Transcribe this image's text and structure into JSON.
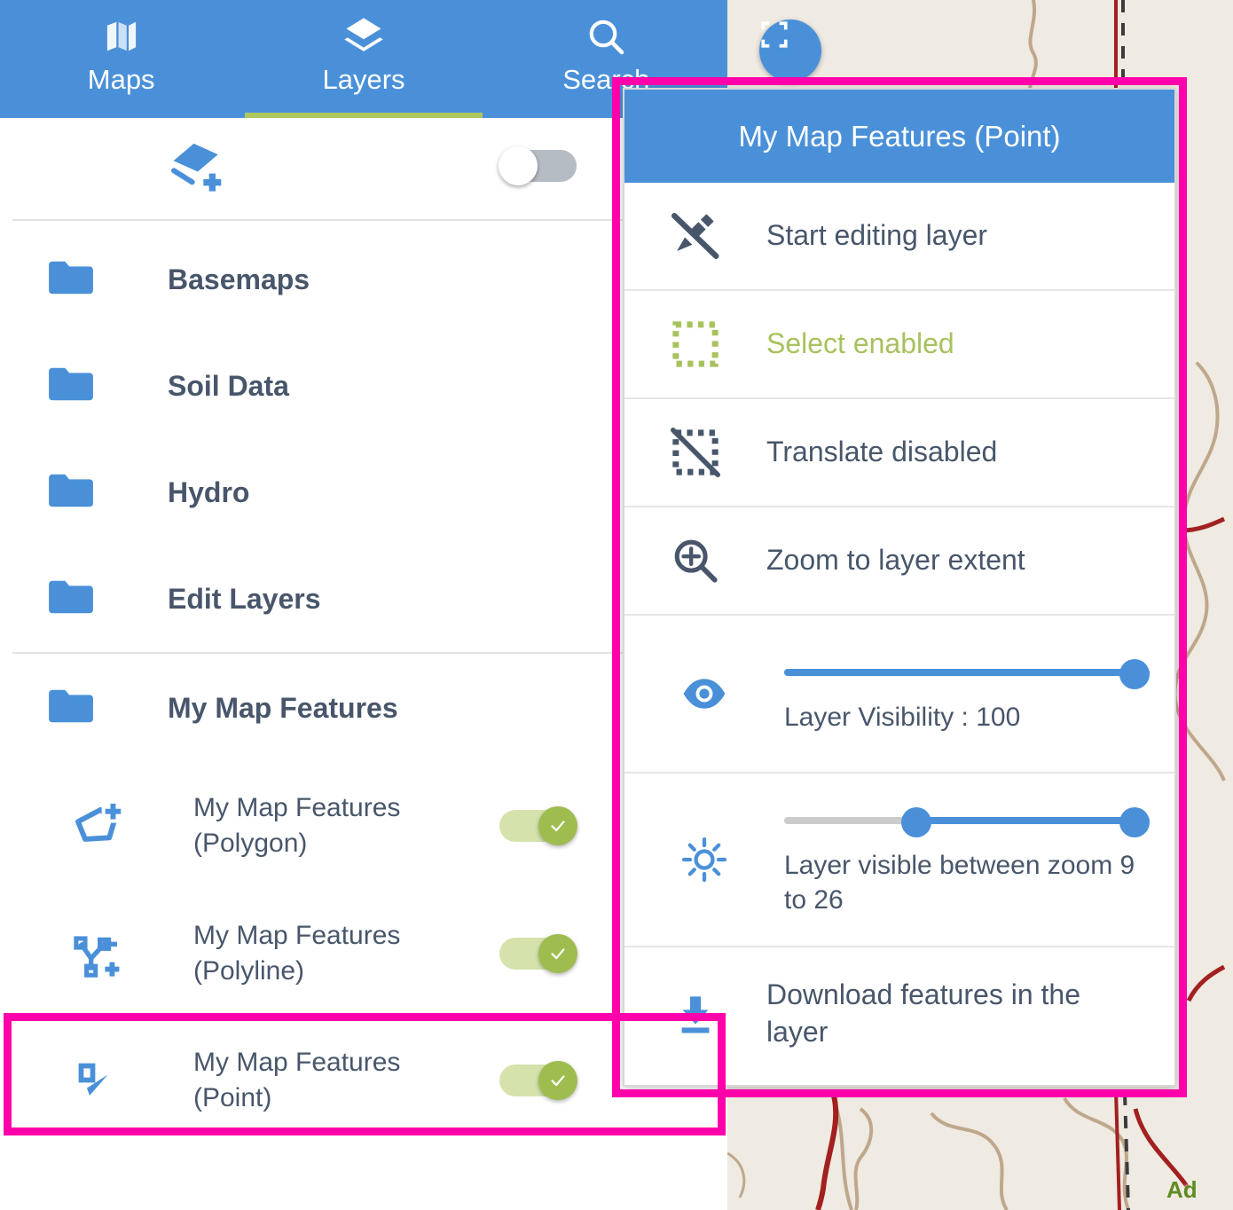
{
  "tabs": [
    {
      "label": "Maps",
      "icon": "map-icon",
      "active": false
    },
    {
      "label": "Layers",
      "icon": "layers-icon",
      "active": true
    },
    {
      "label": "Search",
      "icon": "search-icon",
      "active": false
    }
  ],
  "add_layer_row": {
    "icon": "add-layer-icon",
    "toggle_state": "off"
  },
  "layer_groups": [
    {
      "label": "Basemaps",
      "icon": "folder-icon"
    },
    {
      "label": "Soil Data",
      "icon": "folder-icon"
    },
    {
      "label": "Hydro",
      "icon": "folder-icon"
    },
    {
      "label": "Edit Layers",
      "icon": "folder-icon"
    }
  ],
  "my_map_features": {
    "label": "My Map Features",
    "icon": "folder-icon",
    "sublayers": [
      {
        "label": "My Map Features (Polygon)",
        "icon": "polygon-add-icon",
        "toggle_state": "on",
        "highlighted": false
      },
      {
        "label": "My Map Features (Polyline)",
        "icon": "polyline-add-icon",
        "toggle_state": "on",
        "highlighted": false
      },
      {
        "label": "My Map Features (Point)",
        "icon": "point-edit-icon",
        "toggle_state": "on",
        "highlighted": true
      }
    ]
  },
  "popup": {
    "title": "My Map Features (Point)",
    "items": [
      {
        "label": "Start editing layer",
        "icon": "edit-off-icon",
        "color": "default"
      },
      {
        "label": "Select enabled",
        "icon": "select-dashed-icon",
        "color": "green"
      },
      {
        "label": "Translate disabled",
        "icon": "translate-off-icon",
        "color": "default"
      },
      {
        "label": "Zoom to layer extent",
        "icon": "zoom-in-icon",
        "color": "default"
      }
    ],
    "visibility_slider": {
      "icon": "eye-icon",
      "caption": "Layer Visibility : 100",
      "value": 100,
      "min": 0,
      "max": 100
    },
    "zoom_range_slider": {
      "icon": "brightness-icon",
      "caption": "Layer visible between zoom 9 to 26",
      "min_value": 9,
      "max_value": 26,
      "min": 0,
      "max": 26
    },
    "download_item": {
      "label": "Download features in the layer",
      "icon": "download-icon"
    }
  },
  "map": {
    "fullscreen_button_icon": "fullscreen-icon",
    "label_ad": "Ad"
  },
  "colors": {
    "brand_blue": "#4a90d9",
    "accent_green": "#a7c25d",
    "highlight_pink": "#ff00aa",
    "text_dark": "#48566b",
    "map_bg": "#efeae2"
  }
}
